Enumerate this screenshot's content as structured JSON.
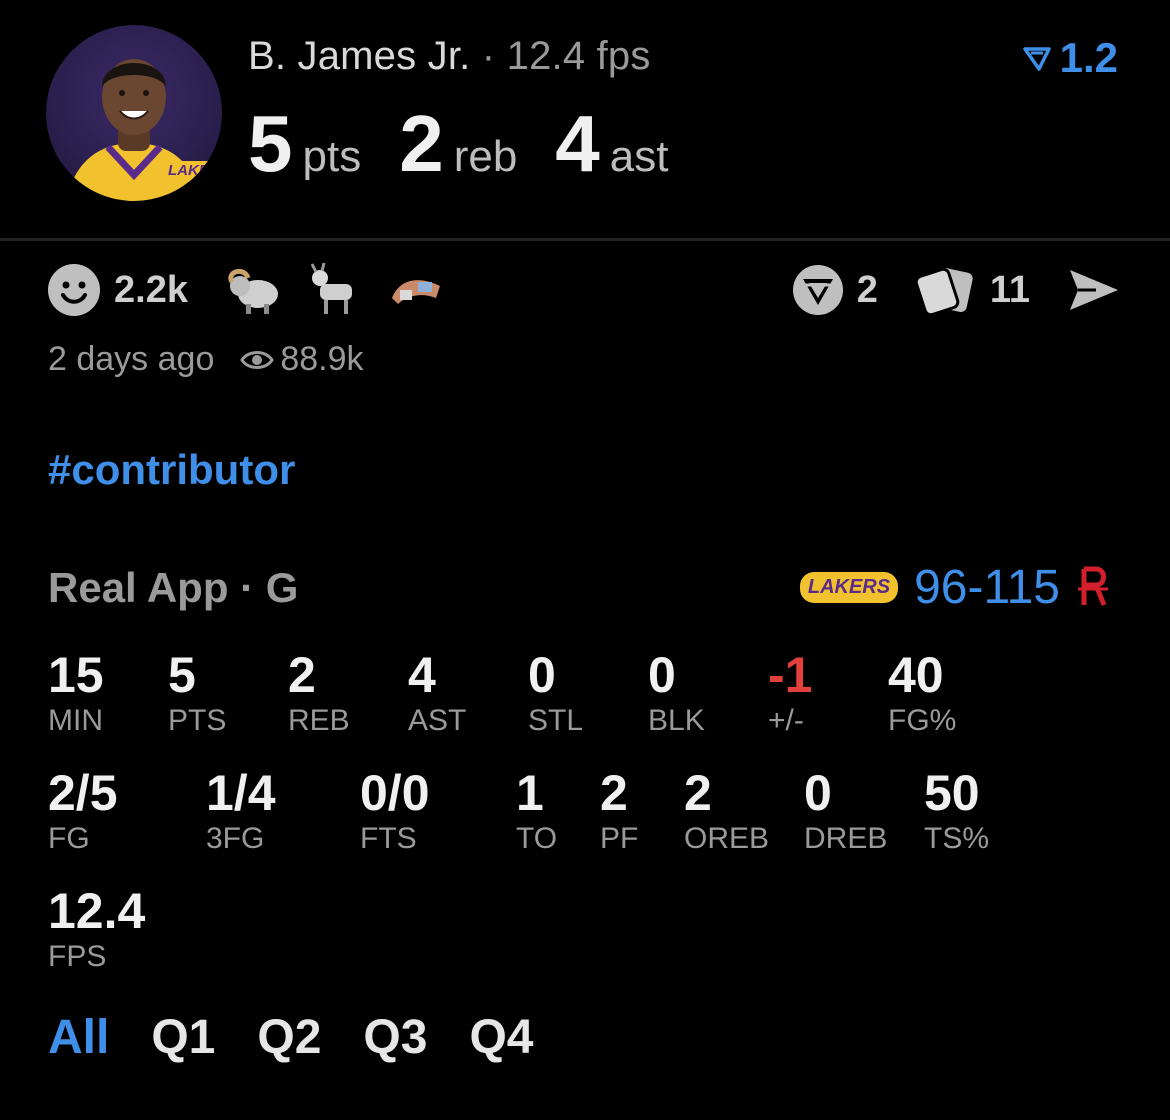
{
  "header": {
    "name": "B. James Jr.",
    "fps_label": "· 12.4 fps",
    "vote_value": "1.2",
    "pts": "5",
    "pts_unit": "pts",
    "reb": "2",
    "reb_unit": "reb",
    "ast": "4",
    "ast_unit": "ast",
    "avatar_logo": "LAKERS"
  },
  "reactions": {
    "count": "2.2k",
    "icons": [
      "ram-icon",
      "goat-icon",
      "player-sticker-icon"
    ]
  },
  "actions": {
    "votes": "2",
    "cards": "11"
  },
  "meta": {
    "time_ago": "2 days ago",
    "views": "88.9k"
  },
  "tag": "#contributor",
  "game": {
    "source": "Real App · G",
    "score": "96-115",
    "home_logo": "LAKERS"
  },
  "stats_row1": [
    {
      "v": "15",
      "l": "MIN"
    },
    {
      "v": "5",
      "l": "PTS"
    },
    {
      "v": "2",
      "l": "REB"
    },
    {
      "v": "4",
      "l": "AST"
    },
    {
      "v": "0",
      "l": "STL"
    },
    {
      "v": "0",
      "l": "BLK"
    },
    {
      "v": "-1",
      "l": "+/-"
    },
    {
      "v": "40",
      "l": "FG%"
    }
  ],
  "stats_row2": [
    {
      "v": "2/5",
      "l": "FG"
    },
    {
      "v": "1/4",
      "l": "3FG"
    },
    {
      "v": "0/0",
      "l": "FTS"
    },
    {
      "v": "1",
      "l": "TO"
    },
    {
      "v": "2",
      "l": "PF"
    },
    {
      "v": "2",
      "l": "OREB"
    },
    {
      "v": "0",
      "l": "DREB"
    },
    {
      "v": "50",
      "l": "TS%"
    }
  ],
  "stats_row3": [
    {
      "v": "12.4",
      "l": "FPS"
    }
  ],
  "periods": [
    "All",
    "Q1",
    "Q2",
    "Q3",
    "Q4"
  ],
  "colors": {
    "accent": "#3f8fe8",
    "negative": "#e0423b",
    "rockets": "#d31f2b"
  }
}
